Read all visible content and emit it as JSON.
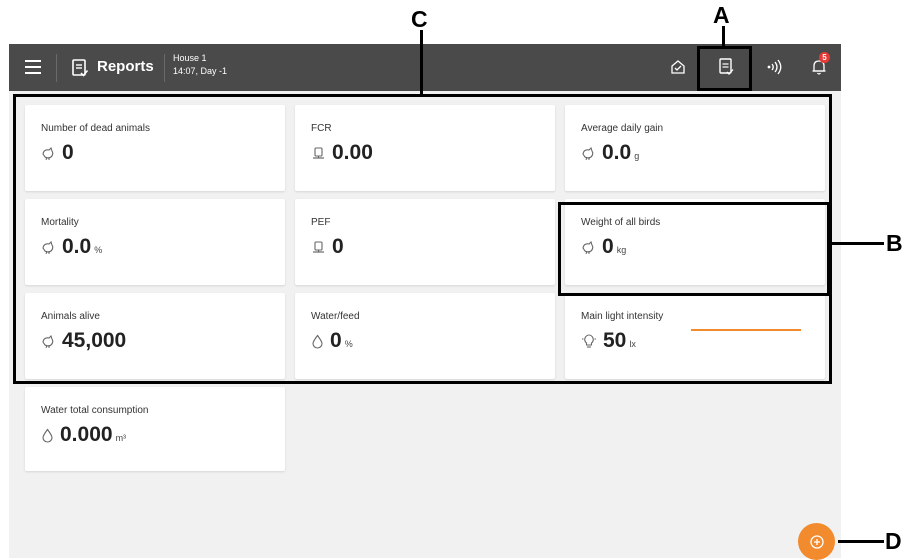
{
  "header": {
    "menu_icon": "hamburger-menu-icon",
    "report_icon": "report-icon",
    "title": "Reports",
    "house_name": "House 1",
    "house_time": "14:07, Day -1",
    "icons": [
      "house-icon",
      "report-icon",
      "signal-icon",
      "bell-icon"
    ],
    "notification_count": "5"
  },
  "cards": [
    {
      "label": "Number of dead animals",
      "value": "0",
      "unit": "",
      "icon": "bird-icon"
    },
    {
      "label": "FCR",
      "value": "0.00",
      "unit": "",
      "icon": "scale-icon"
    },
    {
      "label": "Average daily gain",
      "value": "0.0",
      "unit": "g",
      "icon": "bird-icon"
    },
    {
      "label": "Mortality",
      "value": "0.0",
      "unit": "%",
      "icon": "bird-icon"
    },
    {
      "label": "PEF",
      "value": "0",
      "unit": "",
      "icon": "scale-icon"
    },
    {
      "label": "Weight of all birds",
      "value": "0",
      "unit": "kg",
      "icon": "bird-icon"
    },
    {
      "label": "Animals alive",
      "value": "45,000",
      "unit": "",
      "icon": "bird-icon"
    },
    {
      "label": "Water/feed",
      "value": "0",
      "unit": "%",
      "icon": "water-drop-icon"
    },
    {
      "label": "Main light intensity",
      "value": "50",
      "unit": "lx",
      "icon": "light-bulb-icon"
    },
    {
      "label": "Water total consumption",
      "value": "0.000",
      "unit": "m³",
      "icon": "water-drop-icon"
    }
  ],
  "fab_icon": "add-icon",
  "annotations": {
    "a": "A",
    "b": "B",
    "c": "C",
    "d": "D"
  },
  "colors": {
    "topbar": "#4a4a4a",
    "background": "#f1f1f1",
    "accent": "#f28a2e",
    "badge": "#e53935"
  }
}
